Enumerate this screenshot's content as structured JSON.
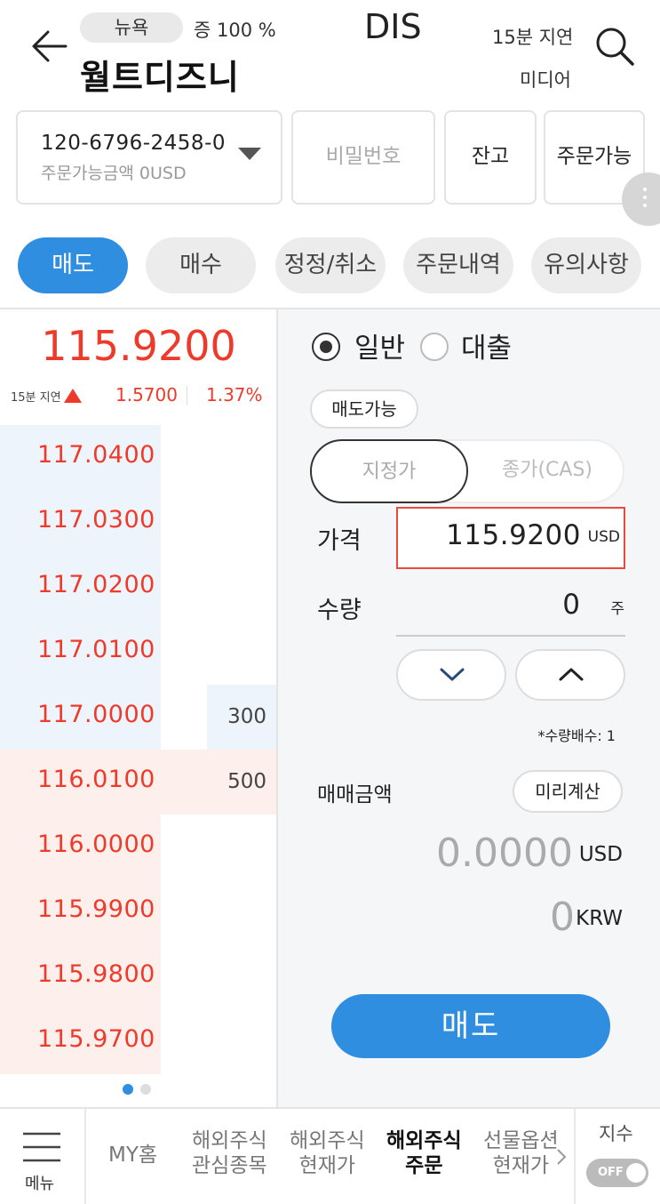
{
  "header": {
    "market": "뉴욕",
    "margin": "증 100 %",
    "ticker": "DIS",
    "name": "월트디즈니",
    "delay": "15분 지연",
    "sector": "미디어"
  },
  "account": {
    "number": "120-6796-2458-0",
    "available_amount": "주문가능금액 0USD",
    "password_placeholder": "비밀번호",
    "balance_label": "잔고",
    "orderable_label": "주문가능"
  },
  "tabs": [
    {
      "label": "매도",
      "active": true
    },
    {
      "label": "매수",
      "active": false
    },
    {
      "label": "정정/취소",
      "active": false
    },
    {
      "label": "주문내역",
      "active": false
    },
    {
      "label": "유의사항",
      "active": false
    }
  ],
  "quote": {
    "price": "115.9200",
    "delay_small": "15분 지연",
    "change": "1.5700",
    "change_pct": "1.37%",
    "direction": "up"
  },
  "orderbook": {
    "asks": [
      {
        "price": "117.0400",
        "qty": ""
      },
      {
        "price": "117.0300",
        "qty": ""
      },
      {
        "price": "117.0200",
        "qty": ""
      },
      {
        "price": "117.0100",
        "qty": ""
      },
      {
        "price": "117.0000",
        "qty": "300"
      }
    ],
    "bids": [
      {
        "price": "116.0100",
        "qty": "500"
      },
      {
        "price": "116.0000",
        "qty": ""
      },
      {
        "price": "115.9900",
        "qty": ""
      },
      {
        "price": "115.9800",
        "qty": ""
      },
      {
        "price": "115.9700",
        "qty": ""
      }
    ]
  },
  "order": {
    "type_general": "일반",
    "type_loan": "대출",
    "sellable_label": "매도가능",
    "limit_label": "지정가",
    "close_label": "종가(CAS)",
    "price_label": "가격",
    "price_value": "115.9200",
    "price_unit": "USD",
    "qty_label": "수량",
    "qty_value": "0",
    "qty_unit": "주",
    "lot_note": "*수량배수: 1",
    "amount_label": "매매금액",
    "preview_label": "미리계산",
    "amount_usd": "0.0000",
    "amount_usd_unit": "USD",
    "amount_krw": "0",
    "amount_krw_unit": "KRW",
    "submit_label": "매도"
  },
  "bottom_nav": {
    "menu_label": "메뉴",
    "my_home": "MY홈",
    "items": [
      {
        "line1": "해외주식",
        "line2": "관심종목"
      },
      {
        "line1": "해외주식",
        "line2": "현재가"
      },
      {
        "line1": "해외주식",
        "line2": "주문"
      },
      {
        "line1": "선물옵션",
        "line2": "현재가"
      }
    ],
    "index_label": "지수",
    "toggle_label": "OFF"
  },
  "colors": {
    "accent": "#2f8ee0",
    "up_red": "#ee3a2a",
    "ask_bg": "#eef4fb",
    "bid_bg": "#fdefec"
  }
}
